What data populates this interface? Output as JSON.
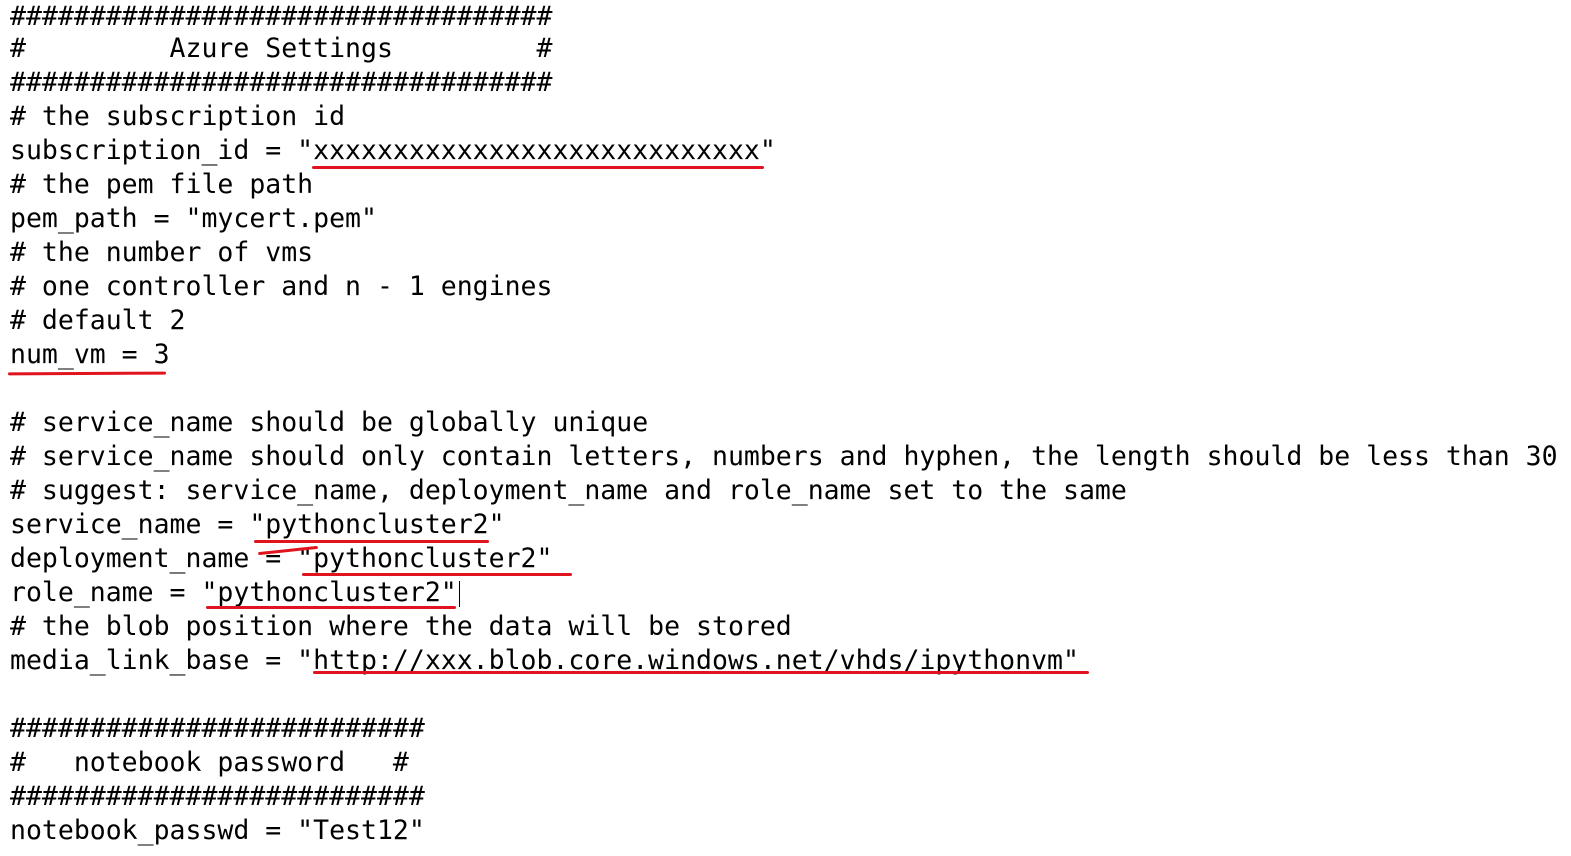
{
  "editor": {
    "lines": [
      "##################################",
      "#         Azure Settings         #",
      "##################################",
      "# the subscription id",
      "subscription_id = \"xxxxxxxxxxxxxxxxxxxxxxxxxxxx\"",
      "# the pem file path",
      "pem_path = \"mycert.pem\"",
      "# the number of vms",
      "# one controller and n - 1 engines",
      "# default 2",
      "num_vm = 3",
      "",
      "# service_name should be globally unique",
      "# service_name should only contain letters, numbers and hyphen, the length should be less than 30",
      "# suggest: service_name, deployment_name and role_name set to the same",
      "service_name = \"pythoncluster2\"",
      "deployment_name = \"pythoncluster2\"",
      "role_name = \"pythoncluster2\"",
      "# the blob position where the data will be stored",
      "media_link_base = \"http://xxx.blob.core.windows.net/vhds/ipythonvm\"",
      "",
      "##########################",
      "#   notebook password   #",
      "##########################",
      "notebook_passwd = \"Test12\""
    ]
  },
  "highlight_color": "#e0141e"
}
